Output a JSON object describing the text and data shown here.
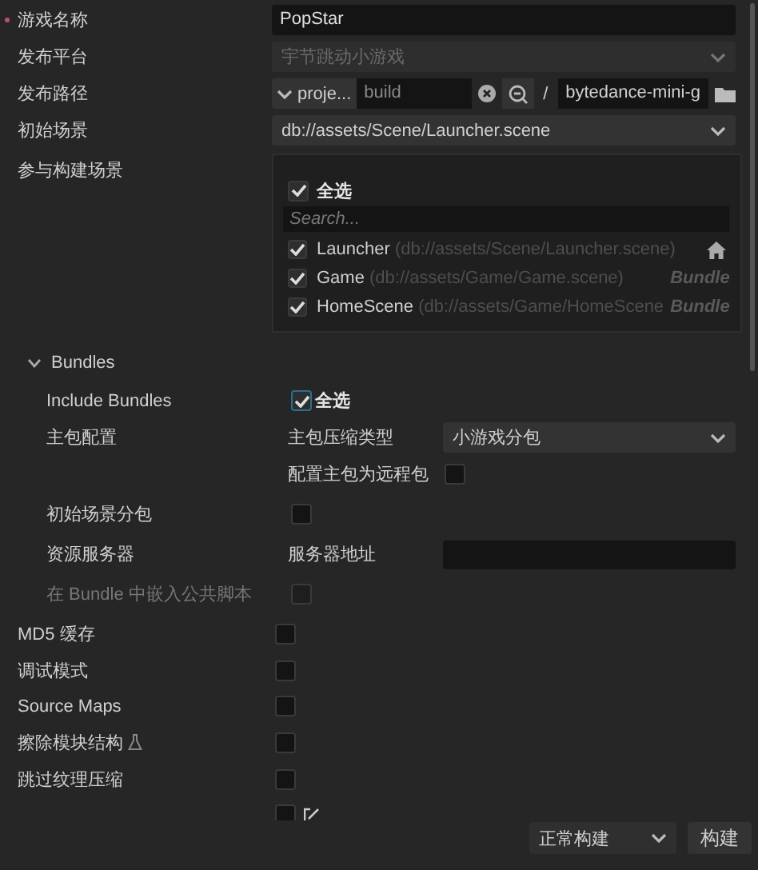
{
  "fields": [
    {
      "kind": "text",
      "label": "游戏名称",
      "required": true,
      "value": "PopStar"
    },
    {
      "kind": "select",
      "label": "发布平台",
      "value": "宇节跳动小游戏",
      "disabled": true
    },
    {
      "kind": "path",
      "label": "发布路径",
      "prefix": "proje...",
      "placeholder": "build",
      "separator": "/",
      "target": "bytedance-mini-g"
    },
    {
      "kind": "select",
      "label": "初始场景",
      "value": "db://assets/Scene/Launcher.scene",
      "disabled": false
    },
    {
      "kind": "scenes",
      "label": "参与构建场景",
      "select_all": {
        "label": "全选",
        "checked": true
      },
      "search": {
        "placeholder": "Search..."
      },
      "scenes": [
        {
          "name": "Launcher",
          "path": "(db://assets/Scene/Launcher.scene)",
          "kind": "home",
          "checked": true
        },
        {
          "name": "Game",
          "path": "(db://assets/Game/Game.scene)",
          "kind": "tagged",
          "tag": "Bundle",
          "checked": true
        },
        {
          "name": "HomeScene",
          "path": "(db://assets/Game/HomeScene",
          "kind": "tagged",
          "tag": "Bundle",
          "checked": true
        }
      ]
    }
  ],
  "bundles": {
    "title": "Bundles",
    "expanded": true,
    "include": {
      "label": "Include Bundles",
      "option": "全选",
      "checked": true
    },
    "main_package": {
      "label": "主包配置",
      "compression": {
        "label": "主包压缩类型",
        "value": "小游戏分包"
      },
      "remote": {
        "label": "配置主包为远程包",
        "checked": false
      }
    },
    "start_scene_subpackage": {
      "label": "初始场景分包",
      "checked": false
    },
    "resource_server": {
      "label": "资源服务器",
      "address": {
        "label": "服务器地址"
      }
    },
    "embed_scripts": {
      "label": "在 Bundle 中嵌入公共脚本",
      "checked": false,
      "disabled": true
    }
  },
  "options": [
    {
      "label": "MD5 缓存",
      "checked": false
    },
    {
      "label": "调试模式",
      "checked": false
    },
    {
      "label": "Source Maps",
      "checked": false
    },
    {
      "label": "擦除模块结构",
      "checked": false,
      "experimental": true
    },
    {
      "label": "跳过纹理压缩",
      "checked": false
    },
    {
      "checked": false,
      "editable": true
    }
  ],
  "footer": {
    "build_mode": "正常构建",
    "build_button": "构建"
  }
}
